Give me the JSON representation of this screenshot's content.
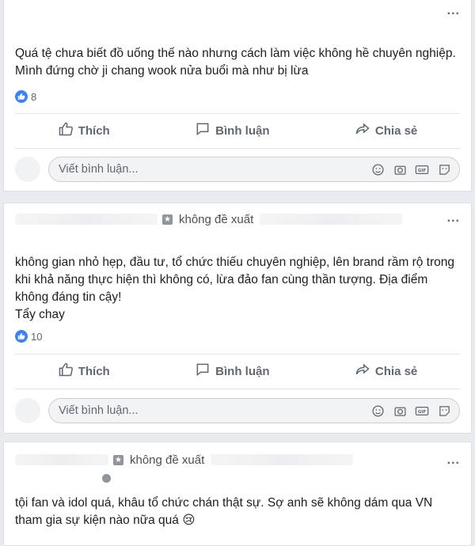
{
  "labels": {
    "like": "Thích",
    "comment": "Bình luận",
    "share": "Chia sẻ",
    "comment_placeholder": "Viết bình luận...",
    "not_recommend": "không đề xuất",
    "more": "..."
  },
  "posts": [
    {
      "text": "Quá tệ chưa biết đồ uống thế nào nhưng cách làm việc không hề chuyên nghiệp.\nMình đứng chờ ji chang wook nửa buổi mà như bị lừa",
      "like_count": "8"
    },
    {
      "text": "không gian nhỏ hẹp, đầu tư, tổ chức thiếu chuyên nghiệp, lên brand rầm rộ trong khi khả năng thực hiện thì không có, lừa đảo fan cùng thần tượng. Địa điểm không đáng tin cậy!\nTẩy chay",
      "like_count": "10"
    },
    {
      "text": "tội fan và idol quá, khâu tổ chức chán thật sự. Sợ anh sẽ không dám qua VN tham gia sự kiện nào nữa quá 😢"
    }
  ],
  "colors": {
    "background": "#e9ebee",
    "card": "#ffffff",
    "muted_text": "#606770",
    "like_blue": "#3b82f6"
  }
}
